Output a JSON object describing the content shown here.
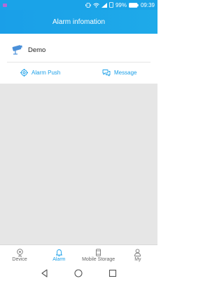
{
  "status_bar": {
    "battery_percent": "99%",
    "time": "09:39",
    "icons": [
      "notification-icon",
      "vibrate-icon",
      "wifi-icon",
      "signal-icon",
      "sim-icon",
      "battery-icon"
    ]
  },
  "header": {
    "title": "Alarm infomation"
  },
  "device": {
    "name": "Demo",
    "icon": "camera-icon"
  },
  "actions": {
    "alarm_push": "Alarm Push",
    "message": "Message"
  },
  "tabs": [
    {
      "label": "Device",
      "icon": "device-icon",
      "active": false
    },
    {
      "label": "Alarm",
      "icon": "bell-icon",
      "active": true
    },
    {
      "label": "Mobile Storage",
      "icon": "storage-icon",
      "active": false
    },
    {
      "label": "My",
      "icon": "person-icon",
      "active": false
    }
  ],
  "colors": {
    "accent": "#1a9fe8",
    "content_background": "#e6e6e6"
  }
}
